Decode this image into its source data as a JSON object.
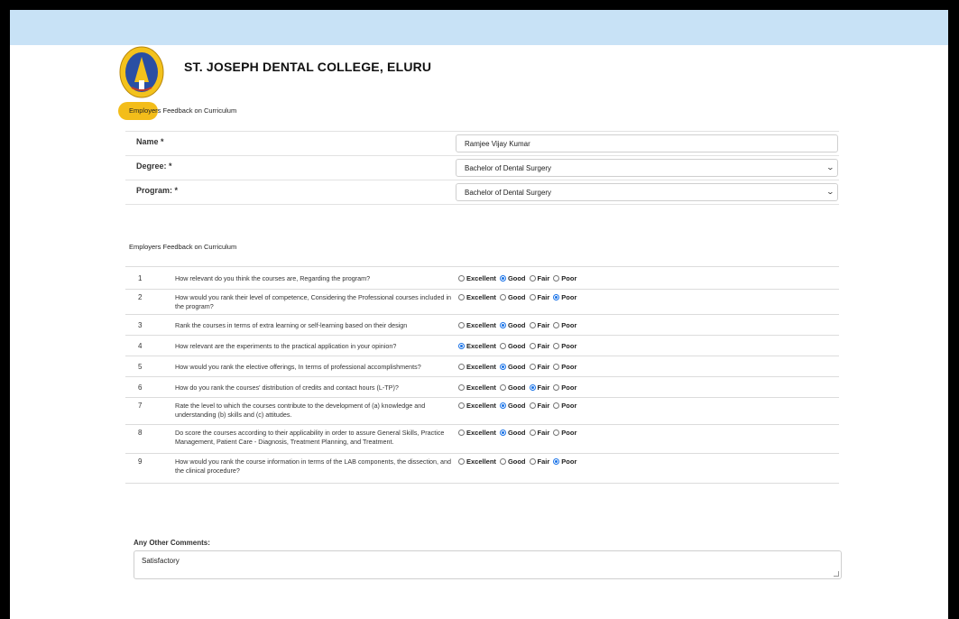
{
  "header": {
    "college_name": "ST. JOSEPH DENTAL COLLEGE, ELURU",
    "breadcrumb": "Employers Feedback on Curriculum"
  },
  "form": {
    "name_label": "Name *",
    "name_value": "Ramjee Vijay Kumar",
    "degree_label": "Degree: *",
    "degree_value": "Bachelor of Dental Surgery",
    "program_label": "Program: *",
    "program_value": "Bachelor of Dental Surgery"
  },
  "section_title": "Employers Feedback on Curriculum",
  "option_labels": [
    "Excellent",
    "Good",
    "Fair",
    "Poor"
  ],
  "questions": [
    {
      "num": "1",
      "text": "How relevant do you think the courses are, Regarding the program?",
      "selected": "Good"
    },
    {
      "num": "2",
      "text": "How would you rank their level of competence, Considering the Professional courses included in the program?",
      "selected": "Poor"
    },
    {
      "num": "3",
      "text": "Rank the courses in terms of extra learning or self-learning based on their design",
      "selected": "Good"
    },
    {
      "num": "4",
      "text": "How relevant are the experiments to the practical application in your opinion?",
      "selected": "Excellent"
    },
    {
      "num": "5",
      "text": "How would you rank the elective offerings, In terms of professional accomplishments?",
      "selected": "Good"
    },
    {
      "num": "6",
      "text": "How do you rank the courses' distribution of credits and contact hours (L-TP)?",
      "selected": "Fair"
    },
    {
      "num": "7",
      "text": "Rate the level to which the courses contribute to the development of (a) knowledge and understanding (b) skills and (c) attitudes.",
      "selected": "Good"
    },
    {
      "num": "8",
      "text": "Do score the courses according to their applicability in order to assure General Skills, Practice Management, Patient Care - Diagnosis, Treatment Planning, and Treatment.",
      "selected": "Good"
    },
    {
      "num": "9",
      "text": "How would you rank the course information in terms of the LAB components, the dissection, and the clinical procedure?",
      "selected": "Poor"
    }
  ],
  "comments": {
    "label": "Any Other Comments:",
    "value": "Satisfactory"
  },
  "colors": {
    "topbar": "#c8e2f6",
    "accent_blob": "#f3bd1a",
    "radio_selected": "#1a73e8"
  }
}
